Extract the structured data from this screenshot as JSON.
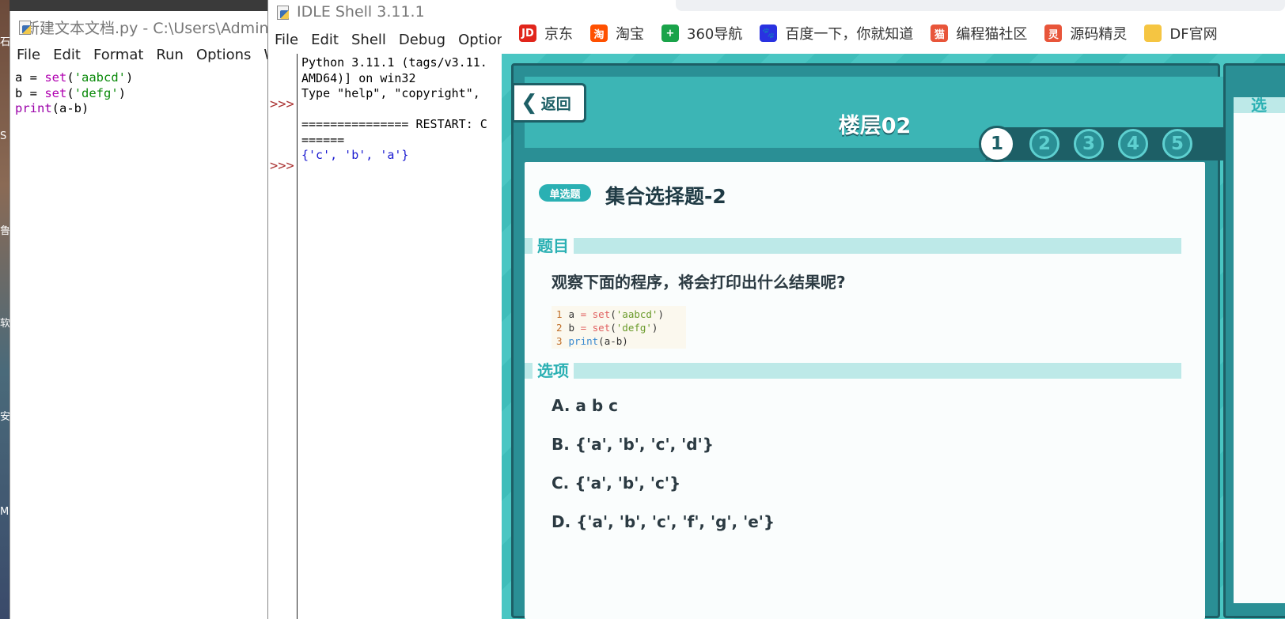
{
  "editor": {
    "title": "新建文本文档.py - C:\\Users\\Admin",
    "menu": [
      "File",
      "Edit",
      "Format",
      "Run",
      "Options",
      "W"
    ]
  },
  "shell": {
    "title": "IDLE Shell 3.11.1",
    "menu": [
      "File",
      "Edit",
      "Shell",
      "Debug",
      "Options"
    ],
    "line1": "Python 3.11.1 (tags/v3.11.",
    "line2": "AMD64)] on win32",
    "line3": "Type \"help\", \"copyright\",",
    "restart": "=============== RESTART: C",
    "restart2": "======",
    "output": "{'c', 'b', 'a'}",
    "prompt": ">>>"
  },
  "bookmarks": [
    {
      "label": "京东",
      "icon": "jd-icon",
      "color": "#e1251b",
      "glyph": "JD"
    },
    {
      "label": "淘宝",
      "icon": "taobao-icon",
      "color": "#ff5000",
      "glyph": "淘"
    },
    {
      "label": "360导航",
      "icon": "360-icon",
      "color": "#1aa34a",
      "glyph": "+"
    },
    {
      "label": "百度一下，你就知道",
      "icon": "baidu-icon",
      "color": "#2932e1",
      "glyph": "🐾"
    },
    {
      "label": "编程猫社区",
      "icon": "codemao-icon",
      "color": "#e8553a",
      "glyph": "猫"
    },
    {
      "label": "源码精灵",
      "icon": "yuanma-icon",
      "color": "#e8553a",
      "glyph": "灵"
    },
    {
      "label": "DF官网",
      "icon": "folder-icon",
      "color": "#f5c542",
      "glyph": ""
    }
  ],
  "quiz": {
    "back": "返回",
    "floor": "楼层02",
    "steps": [
      "1",
      "2",
      "3",
      "4",
      "5"
    ],
    "badge": "单选题",
    "title": "集合选择题-2",
    "section_question": "题目",
    "question": "观察下面的程序，将会打印出什么结果呢?",
    "section_options": "选项",
    "options": [
      "A. a b c",
      "B. {'a', 'b', 'c', 'd'}",
      "C. {'a', 'b', 'c'}",
      "D. {'a', 'b', 'c', 'f', 'g', 'e'}"
    ],
    "right_label": "选"
  },
  "code": {
    "line1_var": "a",
    "line1_arg": "'aabcd'",
    "line2_var": "b",
    "line2_arg": "'defg'",
    "line3": "(a-b)"
  }
}
